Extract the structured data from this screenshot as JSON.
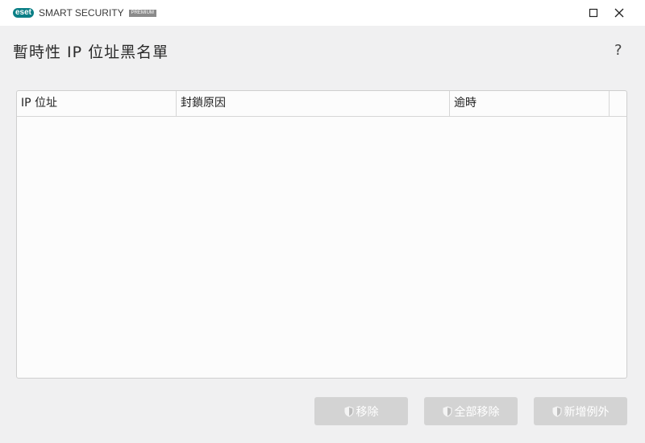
{
  "app": {
    "logo_text": "eset",
    "product_name": "SMART SECURITY",
    "edition_badge": "PREMIUM"
  },
  "window_controls": {
    "maximize_icon": "maximize-icon",
    "close_icon": "close-icon"
  },
  "page": {
    "title": "暫時性 IP 位址黑名單",
    "help_label": "?"
  },
  "table": {
    "columns": [
      "IP 位址",
      "封鎖原因",
      "逾時",
      ""
    ],
    "rows": []
  },
  "actions": {
    "remove_label": "移除",
    "remove_all_label": "全部移除",
    "add_exception_label": "新增例外",
    "button_icon": "shield-icon"
  },
  "colors": {
    "brand": "#0b7f86",
    "disabled_button": "#d3d3d3",
    "background": "#f0f0f1"
  }
}
